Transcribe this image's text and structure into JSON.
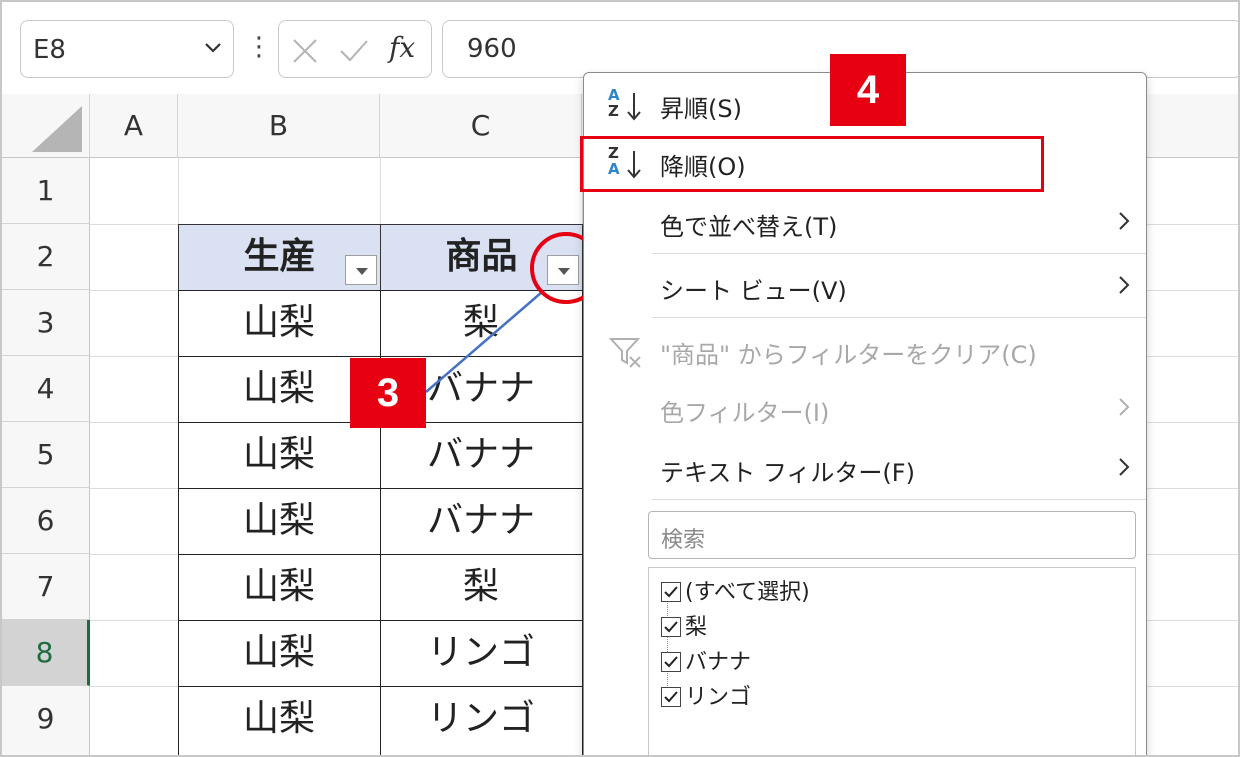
{
  "formula_bar": {
    "name_box": "E8",
    "fx": "fx",
    "value": "960"
  },
  "grid": {
    "columns": [
      "A",
      "B",
      "C"
    ],
    "rows": [
      "1",
      "2",
      "3",
      "4",
      "5",
      "6",
      "7",
      "8",
      "9"
    ],
    "selected_row": "8",
    "table": {
      "headers": [
        "生産",
        "商品"
      ],
      "rows": [
        [
          "山梨",
          "梨"
        ],
        [
          "山梨",
          "バナナ"
        ],
        [
          "山梨",
          "バナナ"
        ],
        [
          "山梨",
          "バナナ"
        ],
        [
          "山梨",
          "梨"
        ],
        [
          "山梨",
          "リンゴ"
        ],
        [
          "山梨",
          "リンゴ"
        ]
      ]
    }
  },
  "callouts": {
    "step3": "3",
    "step4": "4",
    "color": "#e60012"
  },
  "menu": {
    "sort_asc": {
      "label": "昇順(S)",
      "icon_top": "A",
      "icon_bottom": "Z"
    },
    "sort_desc": {
      "label": "降順(O)",
      "icon_top": "Z",
      "icon_bottom": "A"
    },
    "sort_by_color": "色で並べ替え(T)",
    "sheet_view": "シート ビュー(V)",
    "clear_filter": "\"商品\" からフィルターをクリア(C)",
    "color_filter": "色フィルター(I)",
    "text_filter": "テキスト フィルター(F)",
    "search_placeholder": "検索",
    "list_items": [
      "(すべて選択)",
      "梨",
      "バナナ",
      "リンゴ"
    ]
  },
  "icons": {
    "name_box_dropdown": "chevron-down-icon",
    "cancel": "x-icon",
    "enter": "check-icon",
    "submenu": "chevron-right-icon",
    "clear_filter": "funnel-clear-icon"
  }
}
